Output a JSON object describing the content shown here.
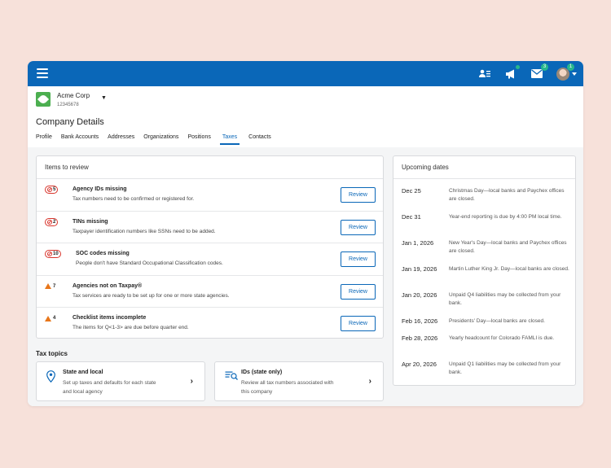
{
  "company": {
    "name": "Acme Corp",
    "id": "12345678"
  },
  "page_title": "Company Details",
  "tabs": [
    "Profile",
    "Bank Accounts",
    "Addresses",
    "Organizations",
    "Positions",
    "Taxes",
    "Contacts"
  ],
  "active_tab": "Taxes",
  "header_badges": {
    "messages": "3",
    "profile": "1"
  },
  "review": {
    "title": "Items to review",
    "items": [
      {
        "count": "5",
        "type": "error",
        "title": "Agency IDs missing",
        "desc": "Tax numbers need to be confirmed or registered for.",
        "button": "Review"
      },
      {
        "count": "2",
        "type": "error",
        "title": "TINs missing",
        "desc": "Taxpayer identification numbers like SSNs need to be added.",
        "button": "Review"
      },
      {
        "count": "10",
        "type": "error",
        "title": "SOC codes missing",
        "desc": "People don't have Standard Occupational Classification codes.",
        "button": "Review"
      },
      {
        "count": "7",
        "type": "warning",
        "title": "Agencies not on Taxpay®",
        "desc": "Tax services are ready to be set up for one or more state agencies.",
        "button": "Review"
      },
      {
        "count": "4",
        "type": "warning",
        "title": "Checklist items incomplete",
        "desc": "The items for Q<1-3> are due before quarter end.",
        "button": "Review"
      }
    ]
  },
  "tax_topics": {
    "title": "Tax topics",
    "cards": [
      {
        "title": "State and local",
        "desc": "Set up taxes and defaults for each state and local agency",
        "icon": "location-pin-icon"
      },
      {
        "title": "IDs (state only)",
        "desc": "Review all tax numbers associated with this company",
        "icon": "id-search-icon"
      }
    ]
  },
  "upcoming": {
    "title": "Upcoming dates",
    "rows": [
      {
        "date": "Dec 25",
        "desc": "Christmas Day—local banks and Paychex offices are closed."
      },
      {
        "date": "Dec 31",
        "desc": "Year-end reporting is due by 4:00 PM local time."
      },
      {
        "date": "Jan 1, 2026",
        "desc": "New Year's Day—local banks and Paychex offices are closed."
      },
      {
        "date": "Jan 19, 2026",
        "desc": "Martin Luther King Jr. Day—local banks are closed."
      },
      {
        "date": "Jan 20, 2026",
        "desc": "Unpaid Q4 liabilities may be collected from your bank."
      },
      {
        "date": "Feb 16, 2026",
        "desc": "Presidents' Day—local banks are closed."
      },
      {
        "date": "Feb 28, 2026",
        "desc": "Yearly headcount for Colorado FAMLI is due."
      },
      {
        "date": "Apr 20, 2026",
        "desc": "Unpaid Q1 liabilities may be collected from your bank."
      }
    ]
  },
  "colors": {
    "brand_blue": "#0a67b8",
    "error_red": "#d8342b",
    "warning_orange": "#e8761a",
    "badge_green": "#27b78d"
  }
}
